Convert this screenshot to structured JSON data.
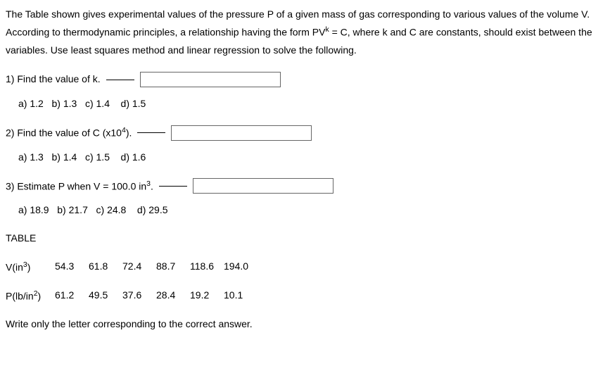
{
  "intro": {
    "line1_pre": "The Table shown gives experimental values of the pressure P of a given mass of gas corresponding to various values of the volume V. According to thermodynamic principles, a relationship having the form PV",
    "exp": "k",
    "line1_post": " = C, where k and C are constants, should exist between the variables. Use least squares method and linear regression to solve the following."
  },
  "q1": {
    "prompt": "1) Find the value of k.",
    "options": {
      "a": "a) 1.2",
      "b": "b) 1.3",
      "c": "c) 1.4",
      "d": "d) 1.5"
    }
  },
  "q2": {
    "prompt_pre": "2) Find the value of C (x10",
    "prompt_sup": "4",
    "prompt_post": ").",
    "options": {
      "a": "a) 1.3",
      "b": "b) 1.4",
      "c": "c) 1.5",
      "d": "d) 1.6"
    }
  },
  "q3": {
    "prompt_pre": "3) Estimate P when V = 100.0 in",
    "prompt_sup": "3",
    "prompt_post": ".",
    "options": {
      "a": "a) 18.9",
      "b": "b) 21.7",
      "c": "c) 24.8",
      "d": "d) 29.5"
    }
  },
  "table": {
    "heading": "TABLE",
    "row_v": {
      "label_pre": "V(in",
      "label_sup": "3",
      "label_post": ")",
      "values": [
        "54.3",
        "61.8",
        "72.4",
        "88.7",
        "118.6",
        "194.0"
      ]
    },
    "row_p": {
      "label_pre": "P(lb/in",
      "label_sup": "2",
      "label_post": ")",
      "values": [
        "61.2",
        "49.5",
        "37.6",
        "28.4",
        "19.2",
        "10.1"
      ]
    }
  },
  "final": "Write only the letter corresponding to the correct answer."
}
